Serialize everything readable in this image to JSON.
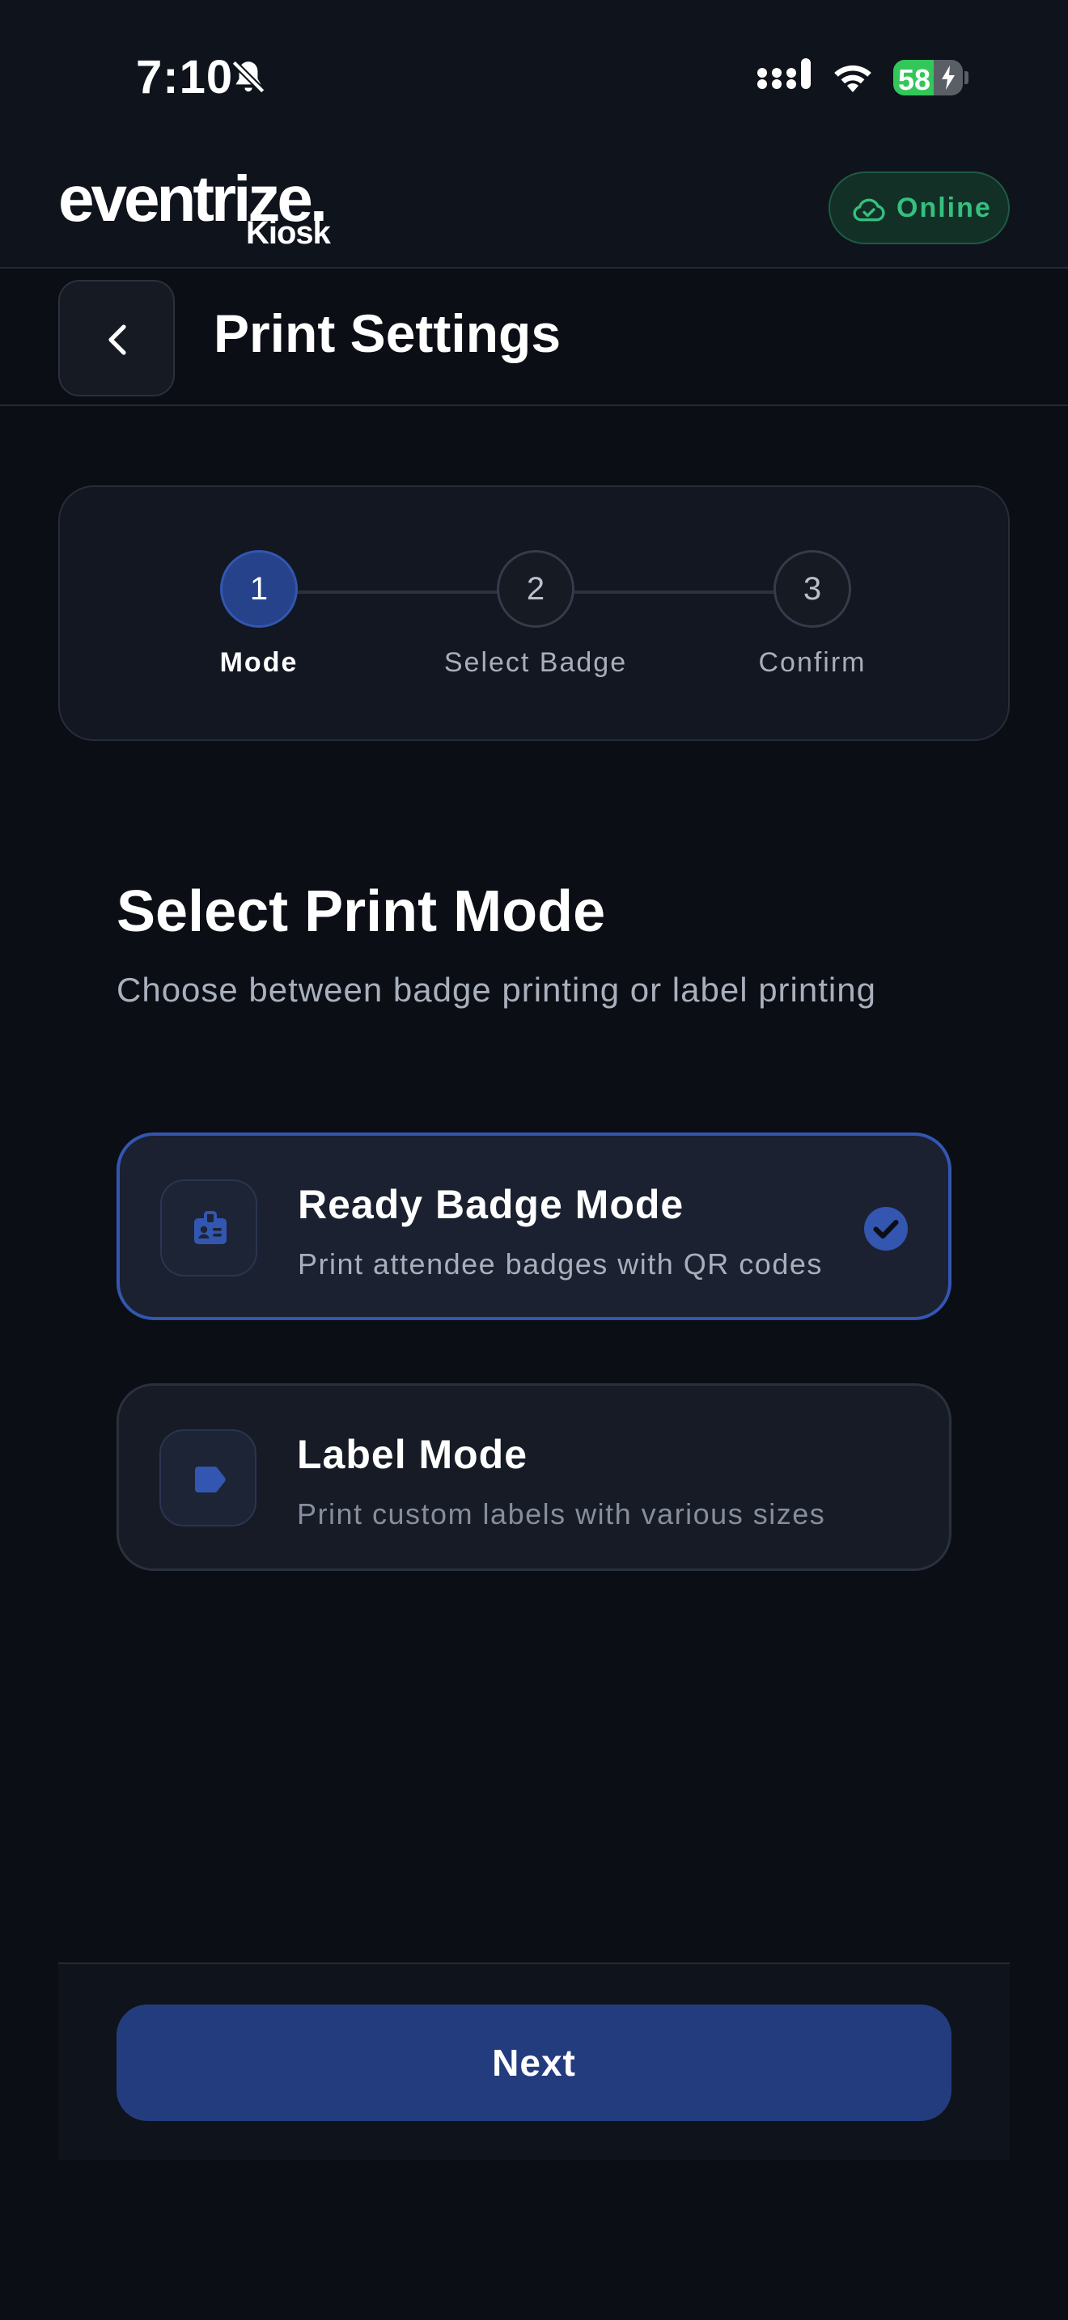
{
  "status_bar": {
    "time": "7:10",
    "battery_percent": "58",
    "battery_level": 0.58,
    "icons": [
      "bell-slash-icon",
      "cellular-signal-icon",
      "wifi-icon",
      "battery-charging-icon"
    ]
  },
  "brand": {
    "logo_text": "eventrize.",
    "logo_subtext": "Kiosk",
    "connection_status": "Online",
    "connection_color": "#34c07f"
  },
  "header": {
    "title": "Print Settings",
    "back_icon": "chevron-left-icon"
  },
  "stepper": {
    "current_step": 1,
    "steps": [
      {
        "number": "1",
        "label": "Mode"
      },
      {
        "number": "2",
        "label": "Select Badge"
      },
      {
        "number": "3",
        "label": "Confirm"
      }
    ]
  },
  "section": {
    "title": "Select Print Mode",
    "subtitle": "Choose between badge printing or label printing"
  },
  "options": [
    {
      "title": "Ready Badge Mode",
      "description": "Print attendee badges with QR codes",
      "icon": "id-badge-icon",
      "selected": true
    },
    {
      "title": "Label Mode",
      "description": "Print custom labels with various sizes",
      "icon": "tag-icon",
      "selected": false
    }
  ],
  "footer": {
    "next_label": "Next"
  },
  "colors": {
    "accent": "#26428a",
    "accent_border": "#3356b0",
    "background": "#0b0e14",
    "online_green": "#34c07f"
  }
}
